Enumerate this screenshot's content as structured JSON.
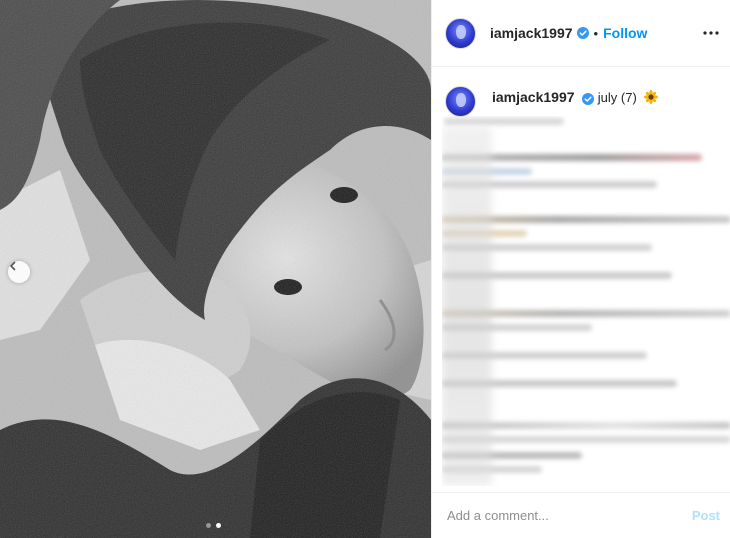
{
  "post": {
    "username": "iamjack1997",
    "separator": "•",
    "follow_label": "Follow",
    "caption": {
      "username": "iamjack1997",
      "text": "july (7)"
    }
  },
  "carousel": {
    "slide_count": 2,
    "active_slide": 2
  },
  "comment_box": {
    "placeholder": "Add a comment...",
    "post_label": "Post"
  },
  "colors": {
    "accent": "#0095f6",
    "post_disabled": "#b2dffc",
    "verified": "#3897f0"
  },
  "icons": {
    "verified": "verified-badge-icon",
    "more": "more-options-icon",
    "prev": "chevron-left-icon",
    "emoji": "sunflower-emoji-icon"
  }
}
